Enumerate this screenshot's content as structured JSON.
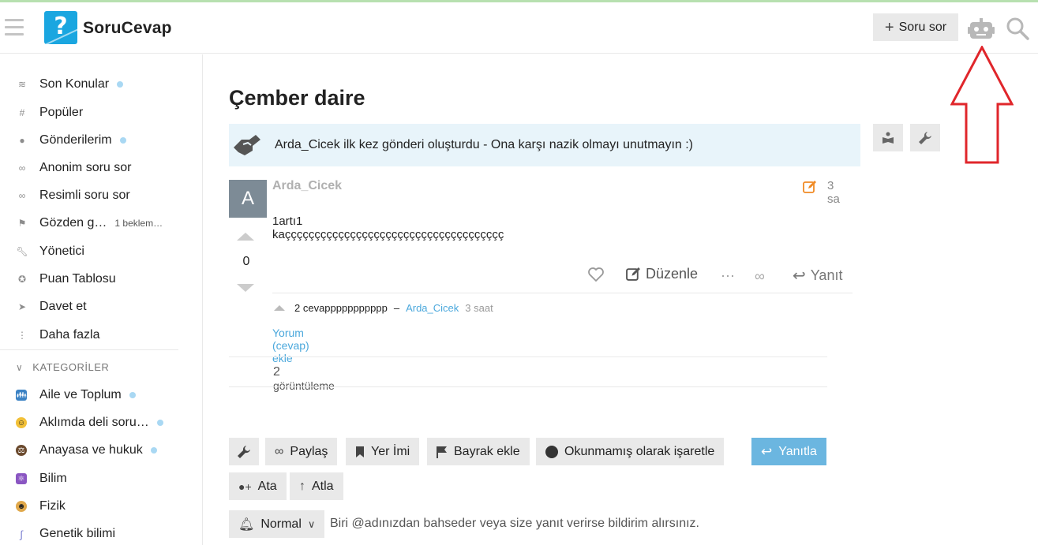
{
  "header": {
    "logo_text": "SoruCevap",
    "logo_mark": "?",
    "ask_button_label": "Soru sor"
  },
  "sidebar": {
    "items": [
      {
        "label": "Son Konular",
        "icon": "layers-icon",
        "dot": true
      },
      {
        "label": "Popüler",
        "icon": "hash-icon",
        "dot": false
      },
      {
        "label": "Gönderilerim",
        "icon": "user-icon",
        "dot": true
      },
      {
        "label": "Anonim soru sor",
        "icon": "link-icon",
        "dot": false
      },
      {
        "label": "Resimli soru sor",
        "icon": "link-icon",
        "dot": false
      },
      {
        "label": "Gözden g…",
        "icon": "flag-icon",
        "dot": false,
        "badge": "1 beklem…"
      },
      {
        "label": "Yönetici",
        "icon": "wrench-icon",
        "dot": false
      },
      {
        "label": "Puan Tablosu",
        "icon": "award-icon",
        "dot": false
      },
      {
        "label": "Davet et",
        "icon": "send-icon",
        "dot": false
      },
      {
        "label": "Daha fazla",
        "icon": "more-vertical-icon",
        "dot": false
      }
    ],
    "categories_heading": "KATEGORİLER",
    "categories": [
      {
        "label": "Aile ve Toplum",
        "icon": "family-icon",
        "dot": true,
        "color": "#3b82c4"
      },
      {
        "label": "Aklımda deli soru…",
        "icon": "crazy-face-icon",
        "dot": true,
        "color": "#f2c037"
      },
      {
        "label": "Anayasa ve hukuk",
        "icon": "judge-icon",
        "dot": true,
        "color": "#6b4a2e"
      },
      {
        "label": "Bilim",
        "icon": "atom-icon",
        "dot": false,
        "color": "#8a56c2"
      },
      {
        "label": "Fizik",
        "icon": "scientist-icon",
        "dot": false,
        "color": "#e0a84b"
      },
      {
        "label": "Genetik bilimi",
        "icon": "dna-icon",
        "dot": false,
        "color": "#7a7fd0"
      }
    ]
  },
  "topic": {
    "title": "Çember daire",
    "notice": "Arda_Cicek ilk kez gönderi oluşturdu - Ona karşı nazik olmayı unutmayın :)",
    "post": {
      "avatar_letter": "A",
      "username": "Arda_Cicek",
      "time": "3 sa",
      "body": "1artı1 kaççççççççççççççççççççççççççççççççççççç",
      "votes": "0",
      "actions": {
        "edit_label": "Düzenle",
        "reply_label": "Yanıt"
      },
      "comment": {
        "text": "2 cevappppppppppp",
        "dash": "–",
        "author": "Arda_Cicek",
        "time": "3 saat"
      },
      "add_comment": "Yorum (cevap) ekle"
    },
    "views_count": "2",
    "views_label": "görüntüleme"
  },
  "footer_buttons": {
    "share": "Paylaş",
    "bookmark": "Yer İmi",
    "flag": "Bayrak ekle",
    "mark_unread": "Okunmamış olarak işaretle",
    "reply": "Yanıtla",
    "assign": "Ata",
    "skip": "Atla",
    "notification_level": "Normal",
    "notification_text": "Biri @adınızdan bahseder veya size yanıt verirse bildirim alırsınız."
  },
  "colors": {
    "accent": "#4ba8dc",
    "primary_button": "#6bb6e0",
    "annotation_arrow": "#e0262b",
    "notice_bg": "#e8f4fa"
  }
}
